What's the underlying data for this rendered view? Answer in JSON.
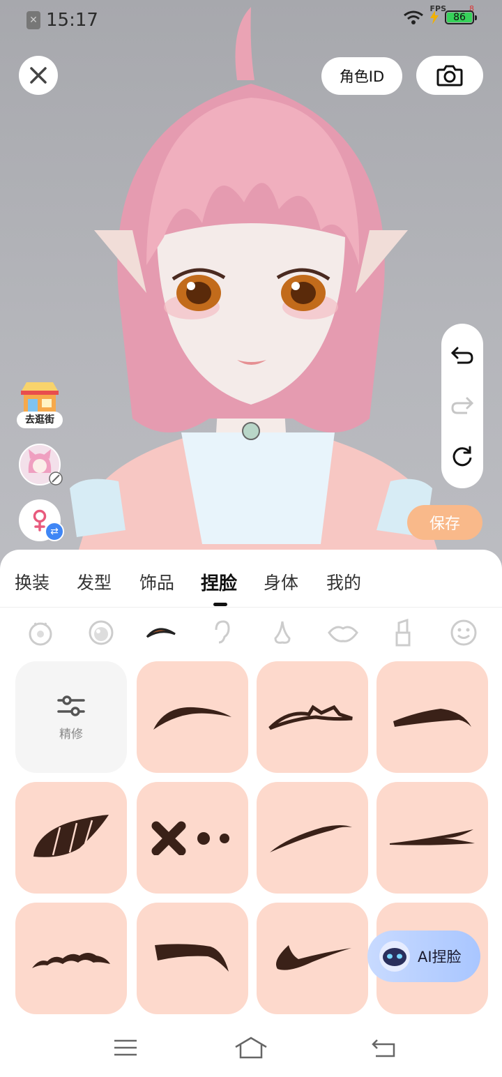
{
  "status_bar": {
    "time": "15:17",
    "fps_label": "FPS",
    "fps_value": "8",
    "battery": "86"
  },
  "top": {
    "role_id_label": "角色ID"
  },
  "left_actions": {
    "street_label": "去逛街"
  },
  "save_label": "保存",
  "tabs": [
    {
      "label": "换装"
    },
    {
      "label": "发型"
    },
    {
      "label": "饰品"
    },
    {
      "label": "捏脸",
      "active": true
    },
    {
      "label": "身体"
    },
    {
      "label": "我的"
    }
  ],
  "subcategories": [
    "face-shape-icon",
    "eye-icon",
    "eyebrow-icon",
    "ear-icon",
    "nose-icon",
    "lips-icon",
    "makeup-icon",
    "expression-icon"
  ],
  "grid": {
    "refine_label": "精修"
  },
  "ai_button_label": "AI捏脸",
  "colors": {
    "card_bg": "#fdd9cc",
    "accent_save": "#f9b98a",
    "brow": "#3a2118",
    "ai_button": "#b3ccff"
  }
}
